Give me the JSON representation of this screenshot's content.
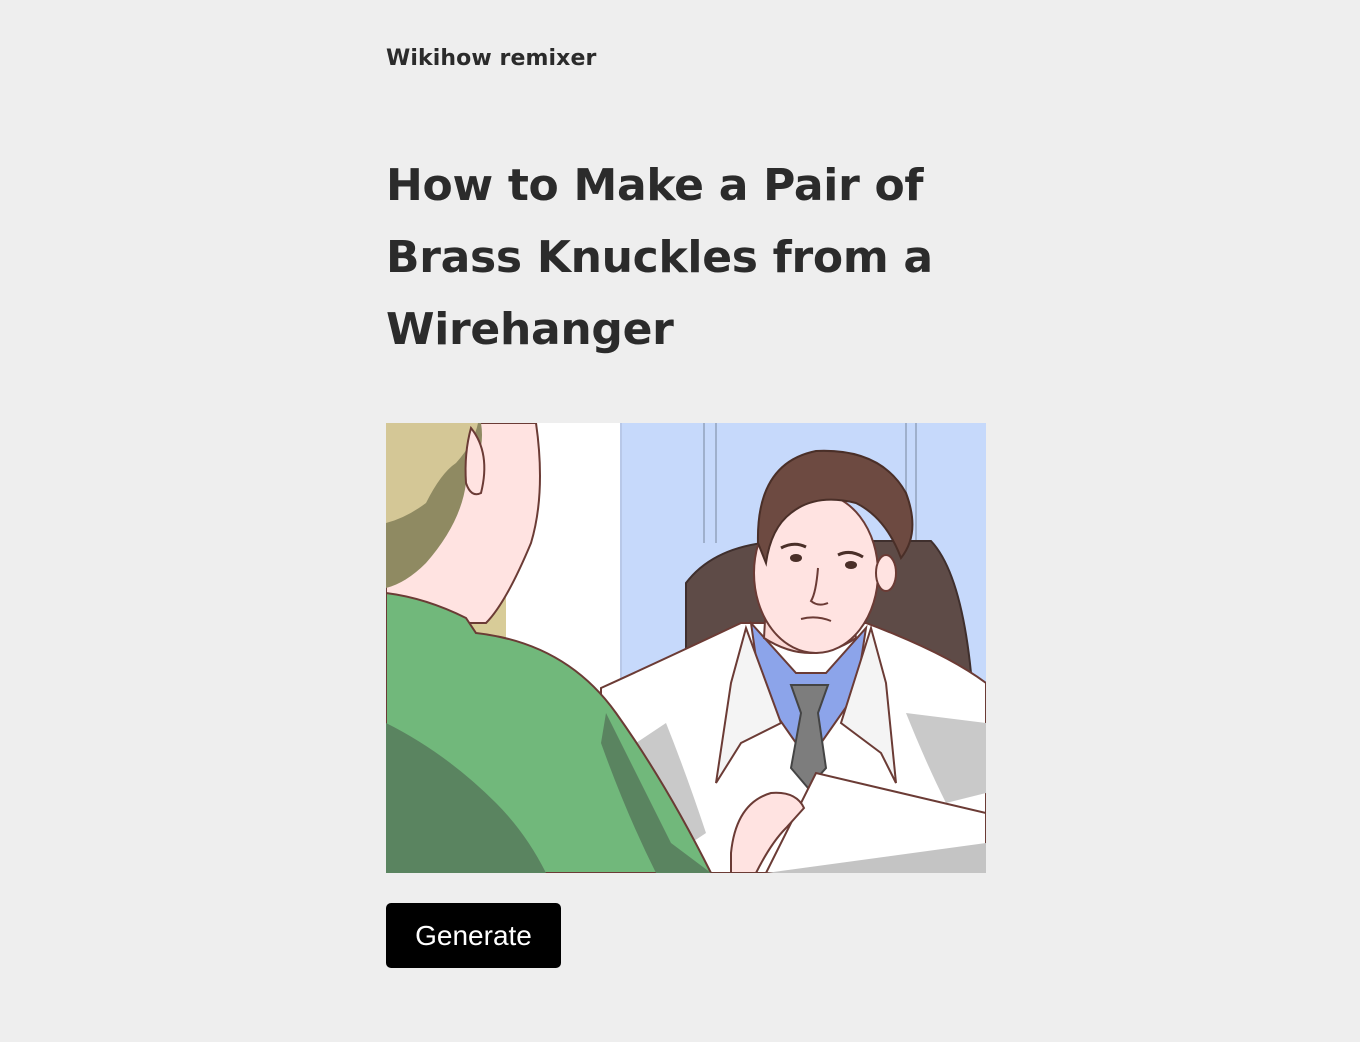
{
  "site": {
    "title": "Wikihow remixer"
  },
  "article": {
    "title": "How to Make a Pair of Brass Knuckles from a Wirehanger",
    "image_description": "Illustration of a man in a white coat speaking to a man in a green shirt",
    "image_icon": "illustration-image"
  },
  "actions": {
    "generate_label": "Generate"
  },
  "colors": {
    "background": "#eeeeee",
    "text": "#2b2b2b",
    "button_bg": "#000000",
    "button_text": "#ffffff"
  }
}
